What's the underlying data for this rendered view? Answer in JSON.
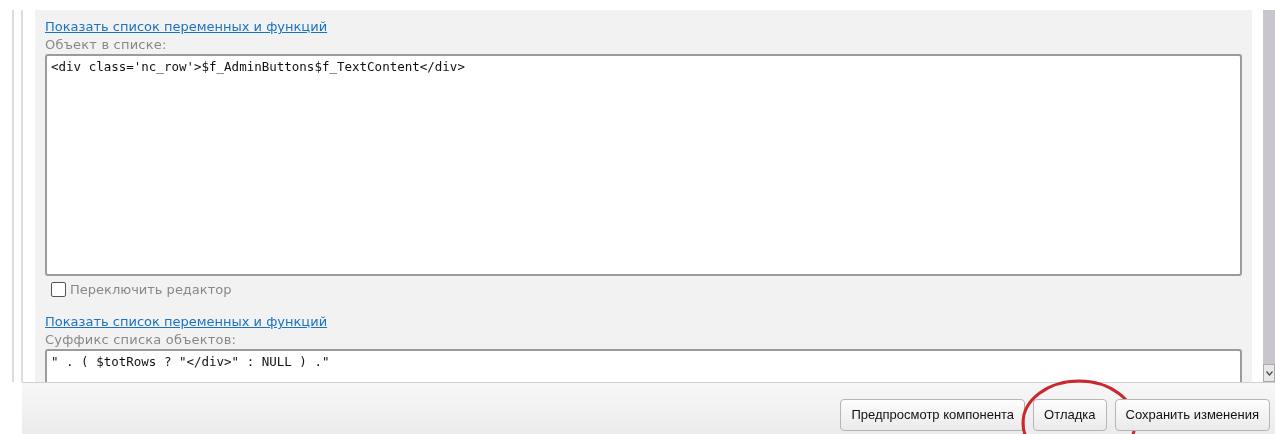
{
  "sections": [
    {
      "link": "Показать список переменных и функций",
      "label": "Объект в списке:",
      "value": "<div class='nc_row'>$f_AdminButtons$f_TextContent</div>",
      "editor_toggle": {
        "label": "Переключить редактор",
        "checked": false
      }
    },
    {
      "link": "Показать список переменных и функций",
      "label": "Суффикс списка объектов:",
      "value": "\" . ( $totRows ? \"</div>\" : NULL ) .\""
    }
  ],
  "buttons": [
    {
      "label": "Предпросмотр компонента",
      "highlighted": false
    },
    {
      "label": "Отладка",
      "highlighted": true
    },
    {
      "label": "Сохранить изменения",
      "highlighted": false
    }
  ]
}
